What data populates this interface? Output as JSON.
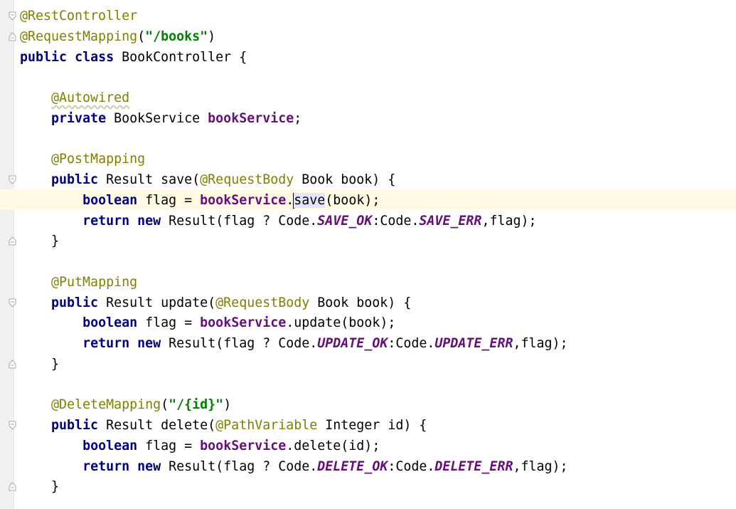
{
  "lines": [
    {
      "indent": "",
      "tokens": [
        {
          "t": "@RestController",
          "c": "ann"
        }
      ]
    },
    {
      "indent": "",
      "tokens": [
        {
          "t": "@RequestMapping",
          "c": "ann"
        },
        {
          "t": "(",
          "c": ""
        },
        {
          "t": "\"/books\"",
          "c": "str"
        },
        {
          "t": ")",
          "c": ""
        }
      ]
    },
    {
      "indent": "",
      "tokens": [
        {
          "t": "public",
          "c": "kw"
        },
        {
          "t": " ",
          "c": ""
        },
        {
          "t": "class",
          "c": "kw"
        },
        {
          "t": " BookController {",
          "c": ""
        }
      ]
    },
    {
      "indent": "",
      "tokens": []
    },
    {
      "indent": "    ",
      "tokens": [
        {
          "t": "@Autowired",
          "c": "ann squiggle"
        }
      ]
    },
    {
      "indent": "    ",
      "tokens": [
        {
          "t": "private",
          "c": "kw"
        },
        {
          "t": " BookService ",
          "c": ""
        },
        {
          "t": "bookService",
          "c": "fld"
        },
        {
          "t": ";",
          "c": ""
        }
      ]
    },
    {
      "indent": "",
      "tokens": []
    },
    {
      "indent": "    ",
      "tokens": [
        {
          "t": "@PostMapping",
          "c": "ann"
        }
      ]
    },
    {
      "indent": "    ",
      "tokens": [
        {
          "t": "public",
          "c": "kw"
        },
        {
          "t": " Result save(",
          "c": ""
        },
        {
          "t": "@RequestBody",
          "c": "ann"
        },
        {
          "t": " Book book) {",
          "c": ""
        }
      ]
    },
    {
      "indent": "        ",
      "tokens": [
        {
          "t": "boolean",
          "c": "kw"
        },
        {
          "t": " flag = ",
          "c": ""
        },
        {
          "t": "bookService",
          "c": "fld"
        },
        {
          "t": ".",
          "c": ""
        },
        {
          "t": "caret",
          "c": "caret"
        },
        {
          "t": "save",
          "c": "hl"
        },
        {
          "t": "(book);",
          "c": ""
        }
      ]
    },
    {
      "indent": "        ",
      "tokens": [
        {
          "t": "return",
          "c": "kw"
        },
        {
          "t": " ",
          "c": ""
        },
        {
          "t": "new",
          "c": "kw"
        },
        {
          "t": " Result(flag ? Code.",
          "c": ""
        },
        {
          "t": "SAVE_OK",
          "c": "cnst"
        },
        {
          "t": ":Code.",
          "c": ""
        },
        {
          "t": "SAVE_ERR",
          "c": "cnst"
        },
        {
          "t": ",flag);",
          "c": ""
        }
      ]
    },
    {
      "indent": "    ",
      "tokens": [
        {
          "t": "}",
          "c": ""
        }
      ]
    },
    {
      "indent": "",
      "tokens": []
    },
    {
      "indent": "    ",
      "tokens": [
        {
          "t": "@PutMapping",
          "c": "ann"
        }
      ]
    },
    {
      "indent": "    ",
      "tokens": [
        {
          "t": "public",
          "c": "kw"
        },
        {
          "t": " Result update(",
          "c": ""
        },
        {
          "t": "@RequestBody",
          "c": "ann"
        },
        {
          "t": " Book book) {",
          "c": ""
        }
      ]
    },
    {
      "indent": "        ",
      "tokens": [
        {
          "t": "boolean",
          "c": "kw"
        },
        {
          "t": " flag = ",
          "c": ""
        },
        {
          "t": "bookService",
          "c": "fld"
        },
        {
          "t": ".update(book);",
          "c": ""
        }
      ]
    },
    {
      "indent": "        ",
      "tokens": [
        {
          "t": "return",
          "c": "kw"
        },
        {
          "t": " ",
          "c": ""
        },
        {
          "t": "new",
          "c": "kw"
        },
        {
          "t": " Result(flag ? Code.",
          "c": ""
        },
        {
          "t": "UPDATE_OK",
          "c": "cnst"
        },
        {
          "t": ":Code.",
          "c": ""
        },
        {
          "t": "UPDATE_ERR",
          "c": "cnst"
        },
        {
          "t": ",flag);",
          "c": ""
        }
      ]
    },
    {
      "indent": "    ",
      "tokens": [
        {
          "t": "}",
          "c": ""
        }
      ]
    },
    {
      "indent": "",
      "tokens": []
    },
    {
      "indent": "    ",
      "tokens": [
        {
          "t": "@DeleteMapping",
          "c": "ann"
        },
        {
          "t": "(",
          "c": ""
        },
        {
          "t": "\"/{id}\"",
          "c": "str"
        },
        {
          "t": ")",
          "c": ""
        }
      ]
    },
    {
      "indent": "    ",
      "tokens": [
        {
          "t": "public",
          "c": "kw"
        },
        {
          "t": " Result delete(",
          "c": ""
        },
        {
          "t": "@PathVariable",
          "c": "ann"
        },
        {
          "t": " Integer id) {",
          "c": ""
        }
      ]
    },
    {
      "indent": "        ",
      "tokens": [
        {
          "t": "boolean",
          "c": "kw"
        },
        {
          "t": " flag = ",
          "c": ""
        },
        {
          "t": "bookService",
          "c": "fld"
        },
        {
          "t": ".delete(id);",
          "c": ""
        }
      ]
    },
    {
      "indent": "        ",
      "tokens": [
        {
          "t": "return",
          "c": "kw"
        },
        {
          "t": " ",
          "c": ""
        },
        {
          "t": "new",
          "c": "kw"
        },
        {
          "t": " Result(flag ? Code.",
          "c": ""
        },
        {
          "t": "DELETE_OK",
          "c": "cnst"
        },
        {
          "t": ":Code.",
          "c": ""
        },
        {
          "t": "DELETE_ERR",
          "c": "cnst"
        },
        {
          "t": ",flag);",
          "c": ""
        }
      ]
    },
    {
      "indent": "    ",
      "tokens": [
        {
          "t": "}",
          "c": ""
        }
      ]
    }
  ],
  "caret_line_index": 9,
  "fold_markers": [
    {
      "line": 0,
      "kind": "open"
    },
    {
      "line": 1,
      "kind": "close"
    },
    {
      "line": 8,
      "kind": "open"
    },
    {
      "line": 11,
      "kind": "close"
    },
    {
      "line": 14,
      "kind": "open"
    },
    {
      "line": 17,
      "kind": "close"
    },
    {
      "line": 20,
      "kind": "open"
    },
    {
      "line": 23,
      "kind": "close"
    }
  ],
  "colors": {
    "keyword": "#000080",
    "annotation": "#808000",
    "string": "#008000",
    "field": "#660e7a",
    "caret_line": "#fffae3",
    "gutter": "#f0f0f0"
  }
}
